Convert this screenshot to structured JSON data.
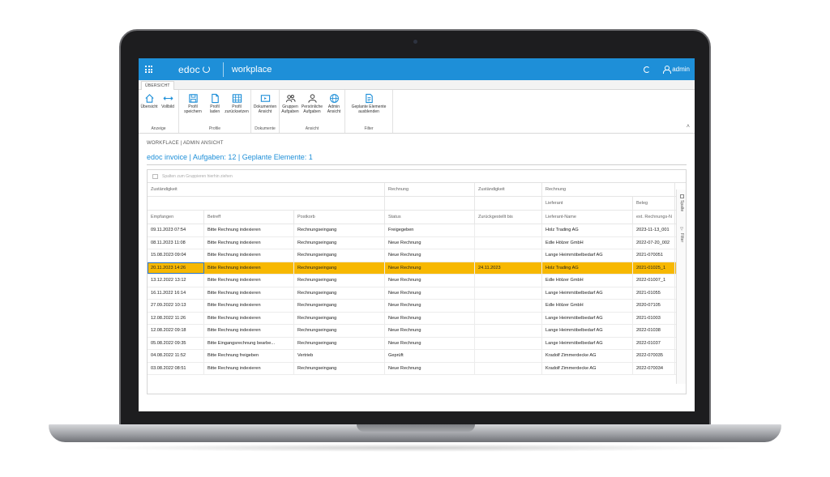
{
  "app": {
    "logo_text": "edoc",
    "name": "workplace",
    "user": "admin",
    "accent_color": "#1e8fd8",
    "highlight_color": "#f7b801"
  },
  "ribbon": {
    "tab": "ÜBERSICHT",
    "groups": [
      {
        "label": "Anzeige",
        "buttons": [
          {
            "label": "Übersicht",
            "icon": "home-icon"
          },
          {
            "label": "Vollbild",
            "icon": "expand-icon"
          }
        ]
      },
      {
        "label": "Profile",
        "buttons": [
          {
            "label": "Profil speichern",
            "icon": "save-icon"
          },
          {
            "label": "Profil laden",
            "icon": "file-icon"
          },
          {
            "label": "Profil zurücksetzen",
            "icon": "grid-reset-icon"
          }
        ]
      },
      {
        "label": "Dokumente",
        "buttons": [
          {
            "label": "Dokumenten Ansicht",
            "icon": "document-view-icon"
          }
        ]
      },
      {
        "label": "Ansicht",
        "buttons": [
          {
            "label": "Gruppen Aufgaben",
            "icon": "group-tasks-icon"
          },
          {
            "label": "Persönliche Aufgaben",
            "icon": "personal-tasks-icon"
          },
          {
            "label": "Admin Ansicht",
            "icon": "admin-globe-icon"
          }
        ]
      },
      {
        "label": "Filter",
        "buttons": [
          {
            "label": "Geplante Elemente ausblenden",
            "icon": "scheduled-items-icon"
          }
        ]
      }
    ]
  },
  "breadcrumb": "WORKFLACE | ADMIN ANSICHT",
  "page_title": "edoc invoice | Aufgaben: 12 | Geplante Elemente: 1",
  "grid": {
    "group_panel_hint": "Spalten zum Gruppieren hierhin ziehen",
    "band_headers": {
      "zustaendigkeit": "Zuständigkeit",
      "rechnung": "Rechnung",
      "zustaendigkeit2": "Zuständigkeit",
      "rechnung2": "Rechnung",
      "lieferant": "Lieferant",
      "beleg": "Beleg"
    },
    "columns": [
      "Empfangen",
      "Betreff",
      "Postkorb",
      "Status",
      "Zurückgestellt bis",
      "Lieferant-Name",
      "ext. Rechnungs-N"
    ],
    "rows": [
      [
        "09.11.2023 07:54",
        "Bitte Rechnung indexieren",
        "Rechnungseingang",
        "Freigegeben",
        "",
        "Holz Trading AG",
        "2023-11-13_001"
      ],
      [
        "08.11.2023 11:08",
        "Bitte Rechnung indexieren",
        "Rechnungseingang",
        "Neue Rechnung",
        "",
        "Edle Hölzer GmbH",
        "2022-07-20_002"
      ],
      [
        "15.08.2023 09:04",
        "Bitte Rechnung indexieren",
        "Rechnungseingang",
        "Neue Rechnung",
        "",
        "Lange Heimmöbelbedarf AG",
        "2021-070051"
      ],
      [
        "20.11.2023 14:26",
        "Bitte Rechnung indexieren",
        "Rechnungseingang",
        "Neue Rechnung",
        "24.11.2023",
        "Holz Trading AG",
        "2021-01025_1"
      ],
      [
        "13.12.2022 13:12",
        "Bitte Rechnung indexieren",
        "Rechnungseingang",
        "Neue Rechnung",
        "",
        "Edle Hölzer GmbH",
        "2022-01007_1"
      ],
      [
        "16.11.2022 16:14",
        "Bitte Rechnung indexieren",
        "Rechnungseingang",
        "Neue Rechnung",
        "",
        "Lange Heimmöbelbedarf AG",
        "2021-01055"
      ],
      [
        "27.09.2022 10:13",
        "Bitte Rechnung indexieren",
        "Rechnungseingang",
        "Neue Rechnung",
        "",
        "Edle Hölzer GmbH",
        "2020-07105"
      ],
      [
        "12.08.2022 11:26",
        "Bitte Rechnung indexieren",
        "Rechnungseingang",
        "Neue Rechnung",
        "",
        "Lange Heimmöbelbedarf AG",
        "2021-01003"
      ],
      [
        "12.08.2022 09:18",
        "Bitte Rechnung indexieren",
        "Rechnungseingang",
        "Neue Rechnung",
        "",
        "Lange Heimmöbelbedarf AG",
        "2022-01038"
      ],
      [
        "05.08.2022 09:35",
        "Bitte Eingangsrechnung bearbe...",
        "Rechnungseingang",
        "Neue Rechnung",
        "",
        "Lange Heimmöbelbedarf AG",
        "2022-01037"
      ],
      [
        "04.08.2022 11:52",
        "Bitte Rechnung freigeben",
        "Vertrieb",
        "Geprüft",
        "",
        "Kradolf Zimmerdecke AG",
        "2022-070035"
      ],
      [
        "03.08.2022 08:51",
        "Bitte Rechnung indexieren",
        "Rechnungseingang",
        "Neue Rechnung",
        "",
        "Kradolf Zimmerdecke AG",
        "2022-070034"
      ]
    ],
    "selected_row": 3
  },
  "side_tabs": {
    "columns": "Spalte",
    "filters": "Filter"
  }
}
